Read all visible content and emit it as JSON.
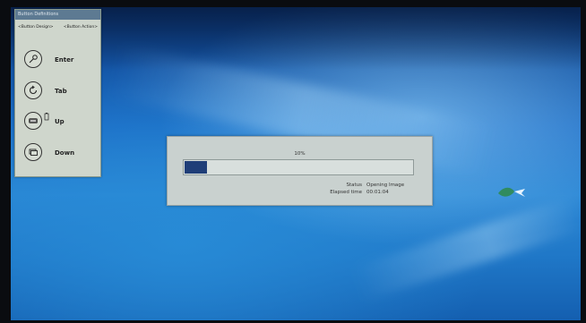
{
  "panel": {
    "title": "Button Definitions",
    "col_design": "<Button Design>",
    "col_action": "<Button Action>",
    "buttons": [
      {
        "icon": "key-icon",
        "label": "Enter"
      },
      {
        "icon": "refresh-icon",
        "label": "Tab"
      },
      {
        "icon": "keyboard-icon",
        "label": "Up"
      },
      {
        "icon": "window-icon",
        "label": "Down"
      }
    ]
  },
  "progress": {
    "percent_text": "10%",
    "fraction": 0.1,
    "status_label": "Status",
    "status_value": "Opening Image",
    "elapsed_label": "Elapsed time",
    "elapsed_value": "00:01:04"
  }
}
